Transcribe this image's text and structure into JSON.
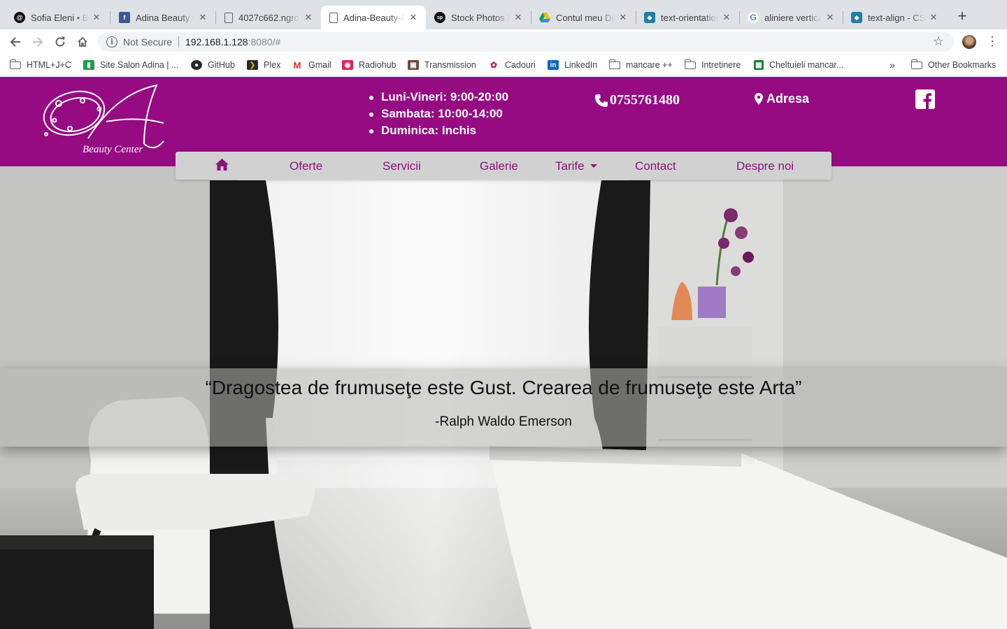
{
  "browser": {
    "tabs": [
      {
        "title": "Sofia Eleni • Be",
        "icon": "threads-icon",
        "active": false
      },
      {
        "title": "Adina Beauty C",
        "icon": "facebook-icon",
        "active": false
      },
      {
        "title": "4027c662.ngro",
        "icon": "page-icon",
        "active": false
      },
      {
        "title": "Adina-Beauty-C",
        "icon": "page-icon",
        "active": true
      },
      {
        "title": "Stock Photos |",
        "icon": "sp-icon",
        "active": false
      },
      {
        "title": "Contul meu Dri",
        "icon": "drive-icon",
        "active": false
      },
      {
        "title": "text-orientation",
        "icon": "mdn-icon",
        "active": false
      },
      {
        "title": "aliniere vertica",
        "icon": "google-icon",
        "active": false
      },
      {
        "title": "text-align - CS",
        "icon": "mdn-icon",
        "active": false
      }
    ],
    "new_tab": "+",
    "omnibox": {
      "security": "Not Secure",
      "host": "192.168.1.128",
      "rest": ":8080/#"
    },
    "bookmarks": [
      {
        "label": "HTML+J+C",
        "icon": "folder-icon"
      },
      {
        "label": "Site Salon Adina | ...",
        "icon": "trello-icon"
      },
      {
        "label": "GitHub",
        "icon": "github-icon"
      },
      {
        "label": "Plex",
        "icon": "plex-icon"
      },
      {
        "label": "Gmail",
        "icon": "gmail-icon"
      },
      {
        "label": "Radiohub",
        "icon": "radio-icon"
      },
      {
        "label": "Transmission",
        "icon": "transmission-icon"
      },
      {
        "label": "Cadouri",
        "icon": "gift-icon"
      },
      {
        "label": "LinkedIn",
        "icon": "linkedin-icon"
      },
      {
        "label": "mancare ++",
        "icon": "folder-icon"
      },
      {
        "label": "Intretinere",
        "icon": "folder-icon"
      },
      {
        "label": "Cheltuieli mancar...",
        "icon": "sheets-icon"
      }
    ],
    "overflow": "»",
    "other_bookmarks": "Other Bookmarks"
  },
  "site": {
    "logo_text": "Beauty Center",
    "logo_monogram": "OA",
    "hours": [
      "Luni-Vineri: 9:00-20:00",
      "Sambata: 10:00-14:00",
      "Duminica: Inchis"
    ],
    "phone": "0755761480",
    "address_label": "Adresa",
    "nav": {
      "home_icon": "home-icon",
      "items": [
        "Oferte",
        "Servicii",
        "Galerie",
        "Tarife",
        "Contact",
        "Despre noi"
      ]
    },
    "quote": "“Dragostea de frumuseţe este Gust. Crearea de frumuseţe este Arta”",
    "author": "-Ralph Waldo Emerson",
    "colors": {
      "brand": "#960a82",
      "nav_text": "#8a127a",
      "nav_bg": "#d1d1d1"
    }
  }
}
